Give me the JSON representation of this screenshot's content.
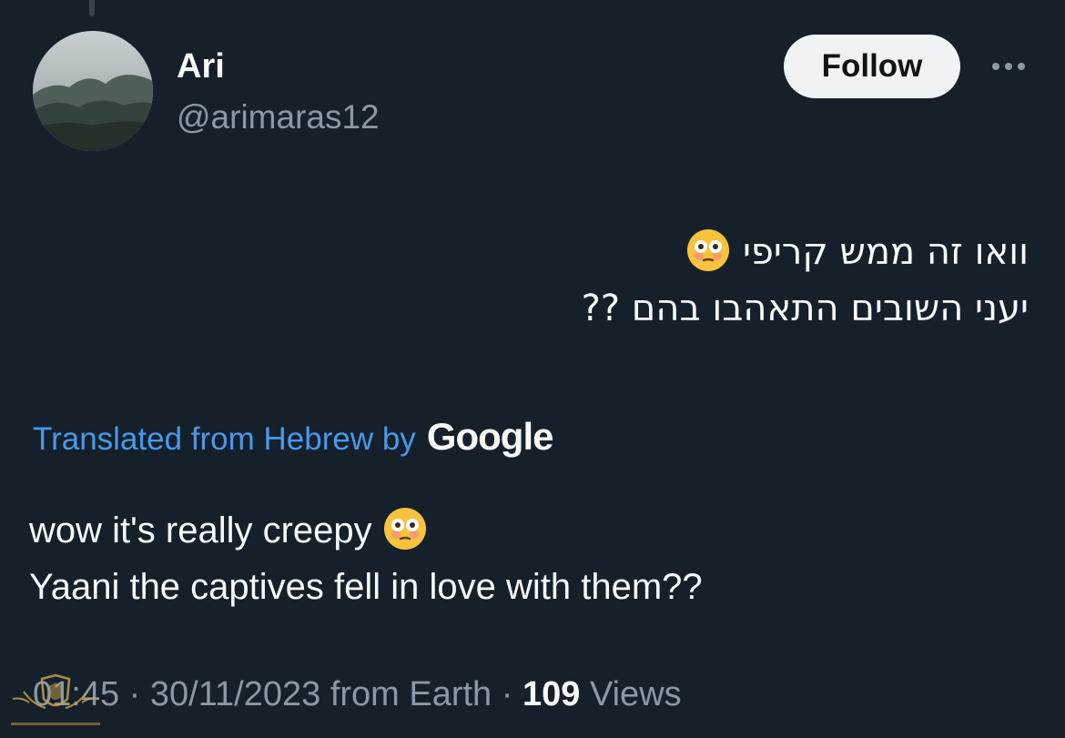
{
  "author": {
    "name": "Ari",
    "handle": "@arimaras12"
  },
  "follow_label": "Follow",
  "more_icon": "more-horizontal-icon",
  "original": {
    "line1": "וואו זה ממש קריפי",
    "line2": "יעני השובים התאהבו בהם ??",
    "emoji": "flushed-face-emoji"
  },
  "translation": {
    "label": "Translated from Hebrew by",
    "provider": "Google",
    "line1": "wow it's really creepy",
    "line2": "Yaani the captives fell in love with them??"
  },
  "meta": {
    "time": "01:45",
    "date": "30/11/2023",
    "source": "from Earth",
    "sep": "·",
    "views_count": "109",
    "views_label": "Views"
  },
  "colors": {
    "background": "#15202b",
    "link": "#4a99e9",
    "secondary_text": "#8b98a5"
  }
}
